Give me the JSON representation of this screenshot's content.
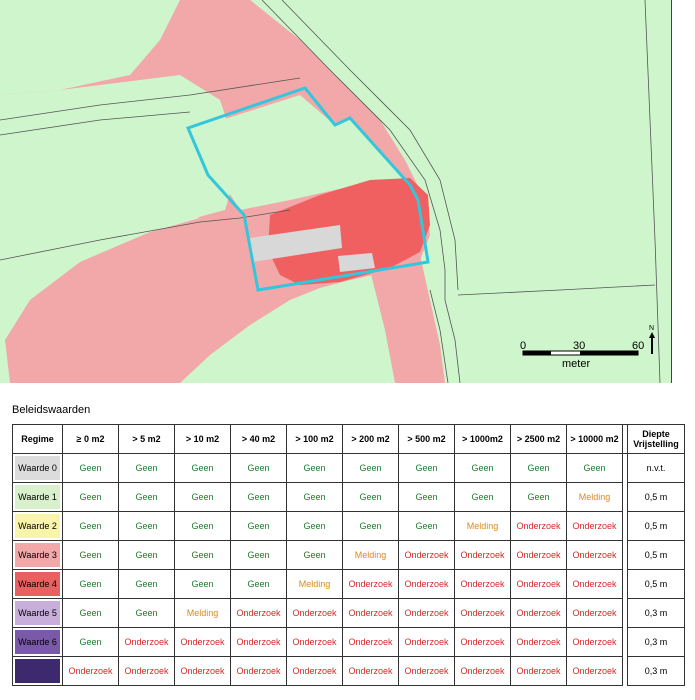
{
  "map": {
    "scalebar": {
      "ticks": [
        "0",
        "30",
        "60"
      ],
      "unit": "meter"
    },
    "north_arrow_label": "N",
    "colors": {
      "background": "#cff5cc",
      "pink_zone": "#f2a8a8",
      "red_zone": "#f06060",
      "building": "#d8d8d8",
      "parcel_outline": "#33c6dc",
      "roads": "#555555"
    }
  },
  "legend_title": "Beleidswaarden",
  "table": {
    "headers": [
      "Regime",
      "≥ 0 m2",
      "> 5 m2",
      "> 10 m2",
      "> 40 m2",
      "> 100 m2",
      "> 200 m2",
      "> 500 m2",
      "> 1000m2",
      "> 2500 m2",
      "> 10000 m2"
    ],
    "depth_header_line1": "Diepte",
    "depth_header_line2": "Vrijstelling",
    "rows": [
      {
        "label": "Waarde 0",
        "color": "#dcdcdc",
        "cells": [
          "Geen",
          "Geen",
          "Geen",
          "Geen",
          "Geen",
          "Geen",
          "Geen",
          "Geen",
          "Geen",
          "Geen"
        ],
        "depth": "n.v.t."
      },
      {
        "label": "Waarde 1",
        "color": "#d8f0cc",
        "cells": [
          "Geen",
          "Geen",
          "Geen",
          "Geen",
          "Geen",
          "Geen",
          "Geen",
          "Geen",
          "Geen",
          "Melding"
        ],
        "depth": "0,5 m"
      },
      {
        "label": "Waarde 2",
        "color": "#f8f5a8",
        "cells": [
          "Geen",
          "Geen",
          "Geen",
          "Geen",
          "Geen",
          "Geen",
          "Geen",
          "Melding",
          "Onderzoek",
          "Onderzoek"
        ],
        "depth": "0,5 m"
      },
      {
        "label": "Waarde 3",
        "color": "#f2a8a8",
        "cells": [
          "Geen",
          "Geen",
          "Geen",
          "Geen",
          "Geen",
          "Melding",
          "Onderzoek",
          "Onderzoek",
          "Onderzoek",
          "Onderzoek"
        ],
        "depth": "0,5 m"
      },
      {
        "label": "Waarde 4",
        "color": "#e86060",
        "cells": [
          "Geen",
          "Geen",
          "Geen",
          "Geen",
          "Melding",
          "Onderzoek",
          "Onderzoek",
          "Onderzoek",
          "Onderzoek",
          "Onderzoek"
        ],
        "depth": "0,5 m"
      },
      {
        "label": "Waarde 5",
        "color": "#c8aedb",
        "cells": [
          "Geen",
          "Geen",
          "Melding",
          "Onderzoek",
          "Onderzoek",
          "Onderzoek",
          "Onderzoek",
          "Onderzoek",
          "Onderzoek",
          "Onderzoek"
        ],
        "depth": "0,3 m"
      },
      {
        "label": "Waarde 6",
        "color": "#7a5aa8",
        "cells": [
          "Geen",
          "Onderzoek",
          "Onderzoek",
          "Onderzoek",
          "Onderzoek",
          "Onderzoek",
          "Onderzoek",
          "Onderzoek",
          "Onderzoek",
          "Onderzoek"
        ],
        "depth": "0,3 m"
      },
      {
        "label": "",
        "color": "#3d2a6e",
        "cells": [
          "Onderzoek",
          "Onderzoek",
          "Onderzoek",
          "Onderzoek",
          "Onderzoek",
          "Onderzoek",
          "Onderzoek",
          "Onderzoek",
          "Onderzoek",
          "Onderzoek"
        ],
        "depth": "0,3 m"
      }
    ]
  }
}
